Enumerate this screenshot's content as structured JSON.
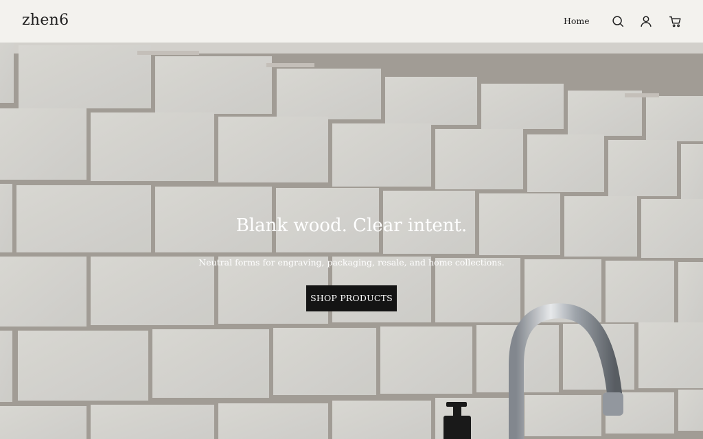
{
  "brand": {
    "logo_text": "zhen6"
  },
  "nav": {
    "home_label": "Home",
    "icons": [
      "search-icon",
      "account-icon",
      "cart-icon"
    ]
  },
  "hero": {
    "title": "Blank wood. Clear intent.",
    "subtitle": "Neutral forms for engraving, packaging, resale, and home collections.",
    "cta_label": "SHOP PRODUCTS"
  },
  "colors": {
    "header_bg": "#f3f2ee",
    "button_bg": "#141414",
    "text_dark": "#1e1e1e",
    "hero_text": "#ffffff"
  }
}
